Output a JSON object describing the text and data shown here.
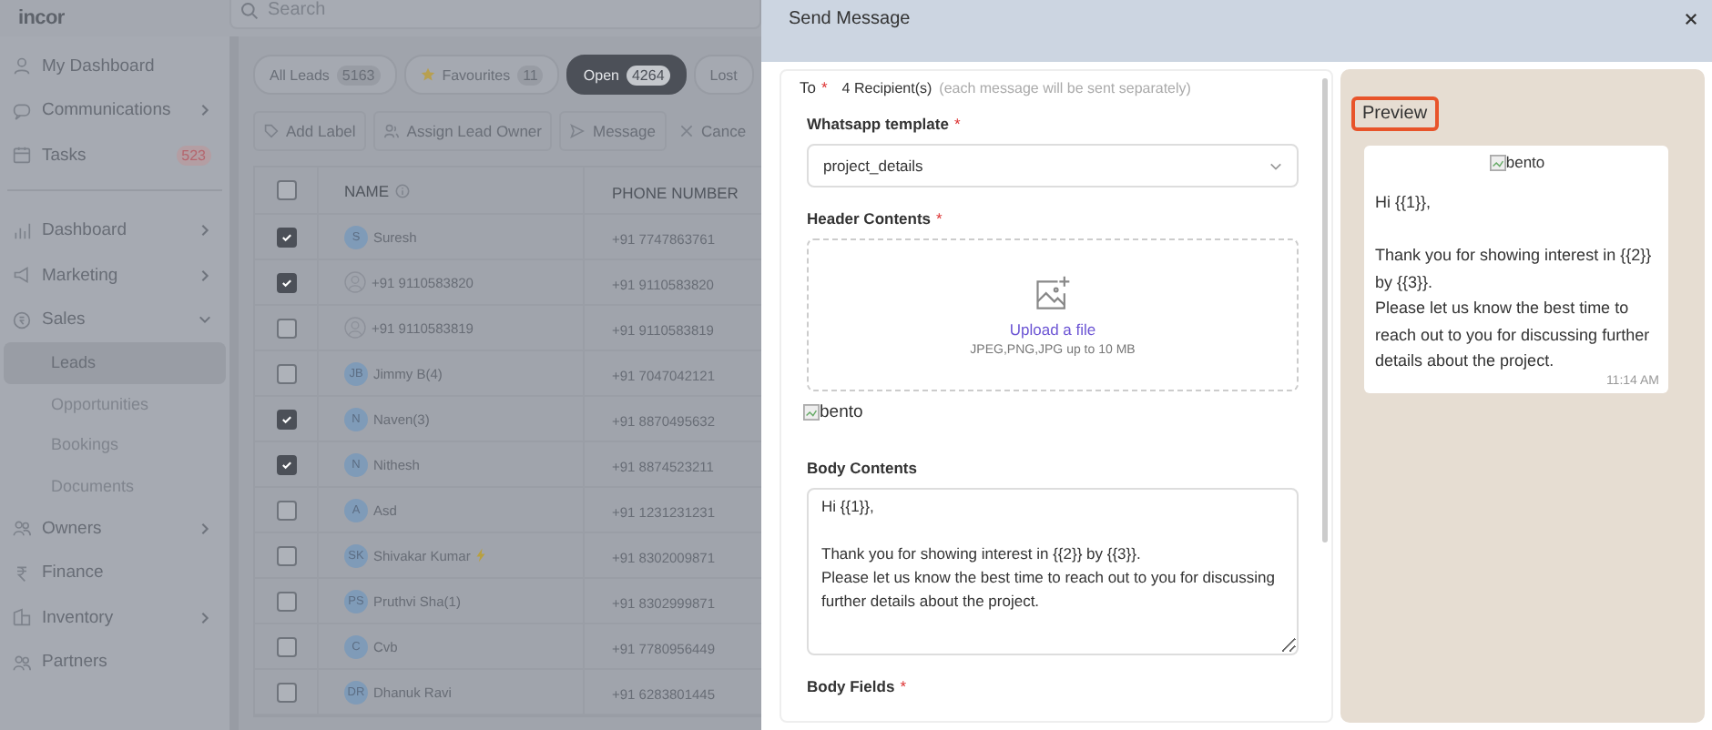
{
  "app": {
    "logo": "incor",
    "search": {
      "placeholder": "Search"
    }
  },
  "sidebar": {
    "items": [
      {
        "label": "My Dashboard",
        "kind": "link"
      },
      {
        "label": "Communications",
        "kind": "group",
        "expanded": false
      },
      {
        "label": "Tasks",
        "kind": "link",
        "badge": "523"
      },
      {
        "label": "Dashboard",
        "kind": "group",
        "expanded": false
      },
      {
        "label": "Marketing",
        "kind": "group",
        "expanded": false
      },
      {
        "label": "Sales",
        "kind": "group",
        "expanded": true,
        "children": [
          {
            "label": "Leads",
            "selected": true
          },
          {
            "label": "Opportunities",
            "selected": false
          },
          {
            "label": "Bookings",
            "selected": false
          },
          {
            "label": "Documents",
            "selected": false
          }
        ]
      },
      {
        "label": "Owners",
        "kind": "group",
        "expanded": false
      },
      {
        "label": "Finance",
        "kind": "link"
      },
      {
        "label": "Inventory",
        "kind": "group",
        "expanded": false
      },
      {
        "label": "Partners",
        "kind": "link"
      }
    ]
  },
  "filters": [
    {
      "label": "All Leads",
      "count": "5163",
      "selected": false,
      "starred": false
    },
    {
      "label": "Favourites",
      "count": "11",
      "selected": false,
      "starred": true
    },
    {
      "label": "Open",
      "count": "4264",
      "selected": true,
      "starred": false
    },
    {
      "label": "Lost",
      "selected": false,
      "starred": false
    }
  ],
  "actions": [
    {
      "label": "Add Label"
    },
    {
      "label": "Assign Lead Owner"
    },
    {
      "label": "Message"
    },
    {
      "label": "Cance"
    }
  ],
  "table": {
    "columns": [
      "NAME",
      "PHONE NUMBER"
    ],
    "all_checked": false,
    "rows": [
      {
        "name": "Suresh",
        "initials": "S",
        "phone": "+91 7747863761",
        "checked": true,
        "hot": false
      },
      {
        "name": "+91 9110583820",
        "phone": "+91 9110583820",
        "checked": true,
        "hot": false
      },
      {
        "name": "+91 9110583819",
        "phone": "+91 9110583819",
        "checked": false,
        "hot": false
      },
      {
        "name": "Jimmy B(4)",
        "initials": "JB",
        "phone": "+91 7047042121",
        "checked": false,
        "hot": false
      },
      {
        "name": "Naven(3)",
        "initials": "N",
        "phone": "+91 8870495632",
        "checked": true,
        "hot": false
      },
      {
        "name": "Nithesh",
        "initials": "N",
        "phone": "+91 8874523211",
        "checked": true,
        "hot": false
      },
      {
        "name": "Asd",
        "initials": "A",
        "phone": "+91 1231231231",
        "checked": false,
        "hot": false
      },
      {
        "name": "Shivakar Kumar",
        "initials": "SK",
        "phone": "+91 8302009871",
        "checked": false,
        "hot": true
      },
      {
        "name": "Pruthvi Sha(1)",
        "initials": "PS",
        "phone": "+91 8302999871",
        "checked": false,
        "hot": false
      },
      {
        "name": "Cvb",
        "initials": "C",
        "phone": "+91 7780956449",
        "checked": false,
        "hot": false
      },
      {
        "name": "Dhanuk Ravi",
        "initials": "DR",
        "phone": "+91 6283801445",
        "checked": false,
        "hot": false
      }
    ]
  },
  "modal": {
    "title": "Send Message",
    "to": {
      "label": "To",
      "mark": "*",
      "recipients": "4 Recipient(s)",
      "note": "(each message will be sent separately)"
    },
    "template": {
      "label": "Whatsapp template",
      "mark": "*",
      "value": "project_details"
    },
    "header": {
      "label": "Header Contents",
      "mark": "*",
      "upload": "Upload a file",
      "hint": "JPEG,PNG,JPG up to 10 MB",
      "image_alt": "bento"
    },
    "body": {
      "label": "Body Contents",
      "value": "Hi {{1}},\n\nThank you for showing interest in {{2}} by {{3}}.\nPlease let us know the best time to reach out to you for discussing further details about the project."
    },
    "body_fields": {
      "label": "Body Fields",
      "mark": "*"
    },
    "preview": {
      "title": "Preview",
      "image_alt": "bento",
      "text": "Hi {{1}},\n\nThank you for showing interest in {{2}} by {{3}}.\nPlease let us know the best time to reach out to you for discussing further details about the project.",
      "time": "11:14 AM"
    }
  }
}
